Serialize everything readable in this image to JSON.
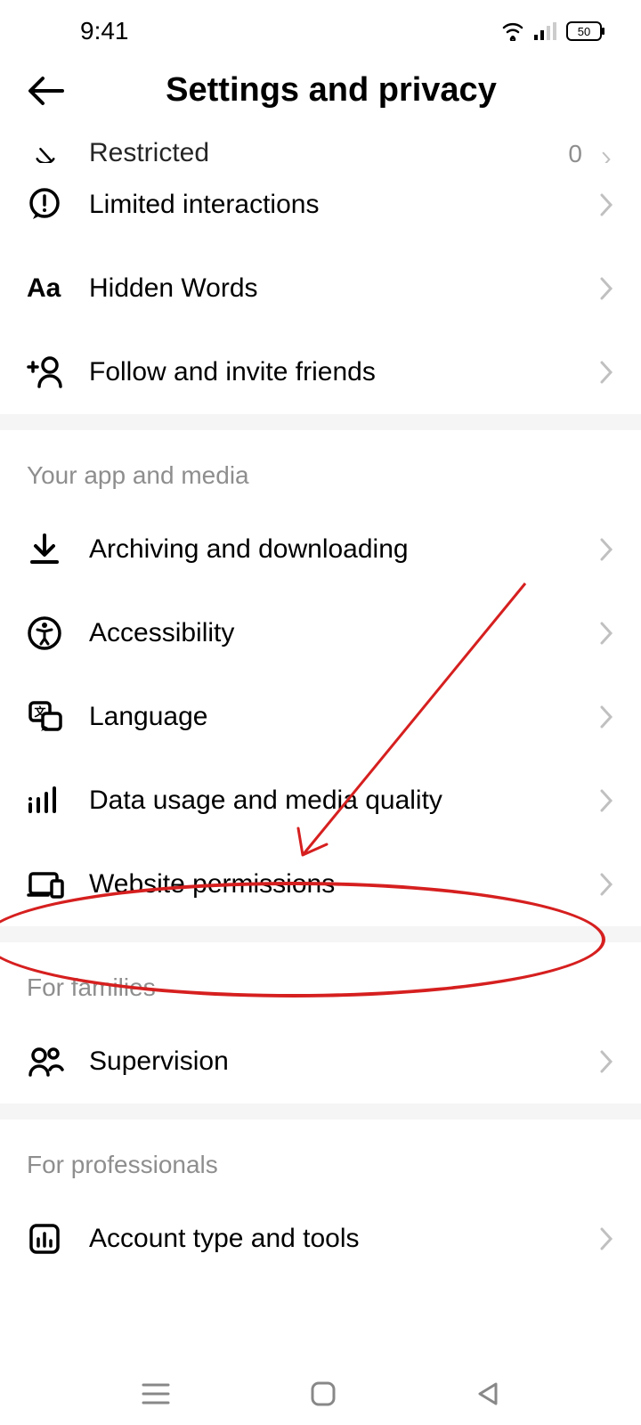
{
  "status": {
    "time": "9:41",
    "battery": "50"
  },
  "header": {
    "title": "Settings and privacy"
  },
  "rows": {
    "restricted": {
      "label": "Restricted",
      "trailing": "0"
    },
    "limited": {
      "label": "Limited interactions"
    },
    "hidden_words": {
      "label": "Hidden Words"
    },
    "follow_invite": {
      "label": "Follow and invite friends"
    },
    "archiving": {
      "label": "Archiving and downloading"
    },
    "accessibility": {
      "label": "Accessibility"
    },
    "language": {
      "label": "Language"
    },
    "data_usage": {
      "label": "Data usage and media quality"
    },
    "website_permissions": {
      "label": "Website permissions"
    },
    "supervision": {
      "label": "Supervision"
    },
    "account_type": {
      "label": "Account type and tools"
    }
  },
  "sections": {
    "app_media": "Your app and media",
    "families": "For families",
    "professionals": "For professionals"
  }
}
